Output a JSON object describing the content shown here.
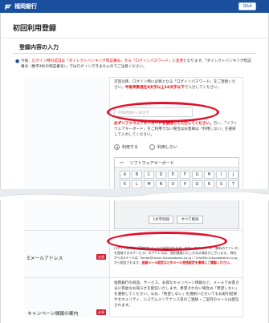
{
  "header": {
    "bank_name": "福岡銀行",
    "qa_label": "Q&A"
  },
  "page": {
    "title": "初回利用登録",
    "section_title": "登録内容の入力"
  },
  "notice": {
    "prefix": "今後、",
    "highlight": "ログイン時の認証は「ダイレクトバンキング暗証番号」から「ログインパスワード」に変更",
    "suffix": "となります。「ダイレクトバンキング暗証番号（数字4桁の暗証番号）」ではログインできませんのでご注意ください。"
  },
  "password_block": {
    "instruction_1": "次回以降、ログイン時に必要となる「ログインパスワード」をご登録ください。",
    "instruction_red": "半角英数混在6文字以上16文字以下",
    "instruction_2": "で入力してください。",
    "input_placeholder": "半角英数6～16文字",
    "soft_kb_red": "必ずソフトウェアキーボードを使用して入力してください。",
    "soft_kb_text": "万一、「ソフトウェアキーボード」をご利用でない場合はお客様は「利用しない」を選択して入力してください。",
    "radio_use": "利用する",
    "radio_not_use": "利用しない"
  },
  "keyboard": {
    "minus": "ー",
    "title": "ソフトウェアキーボード",
    "row1": [
      "A",
      "B",
      "C",
      "D",
      "E",
      "F",
      "G",
      "H",
      "I",
      "J"
    ],
    "row2": [
      "K",
      "L",
      "M",
      "N",
      "O",
      "P",
      "Q",
      "R",
      "S",
      "T"
    ],
    "row3": [
      "U",
      "V",
      "W",
      "X",
      "Y",
      "Z",
      "",
      "",
      "",
      ""
    ],
    "delete_one": "1文字削除",
    "delete_all": "すべて削除"
  },
  "email_row": {
    "label": "Eメールアドレス",
    "badge": "必須",
    "text_1": "ログイン時等のご連絡がEメールで送信されます。",
    "text_2": "なお、フリーメール（無料のアドレス）を登録できるサービス）のアドレスは、個別連絡いたしかねる場合がございます。",
    "text_3": "弊社からのEメールは「bmail@direct.fukuokabank.co.jp」「info@ib.fukuokabank.co.jp」から配信されます。",
    "text_3_red": "迷惑メール設定などのメール受信設定を事前にご確認ください。"
  },
  "campaign_row": {
    "label": "キャンペーン情報の案内",
    "badge": "必須",
    "text": "福岡銀行の商品、サービス、お得なキャンペーン情報など、メールでお客さまに有益なお知らせを配信いたします。希望されない場合は「希望しない」を選択してください。なお、「希望しない」を選択いただいてもお取引結果やセキュリティ、システムメンテナンス等のご連絡・ご案内のメールは配信されます。"
  },
  "colors": {
    "brand_blue": "#1a4f9e",
    "highlight_red": "#e0102b",
    "required_red": "#d61b2d"
  }
}
